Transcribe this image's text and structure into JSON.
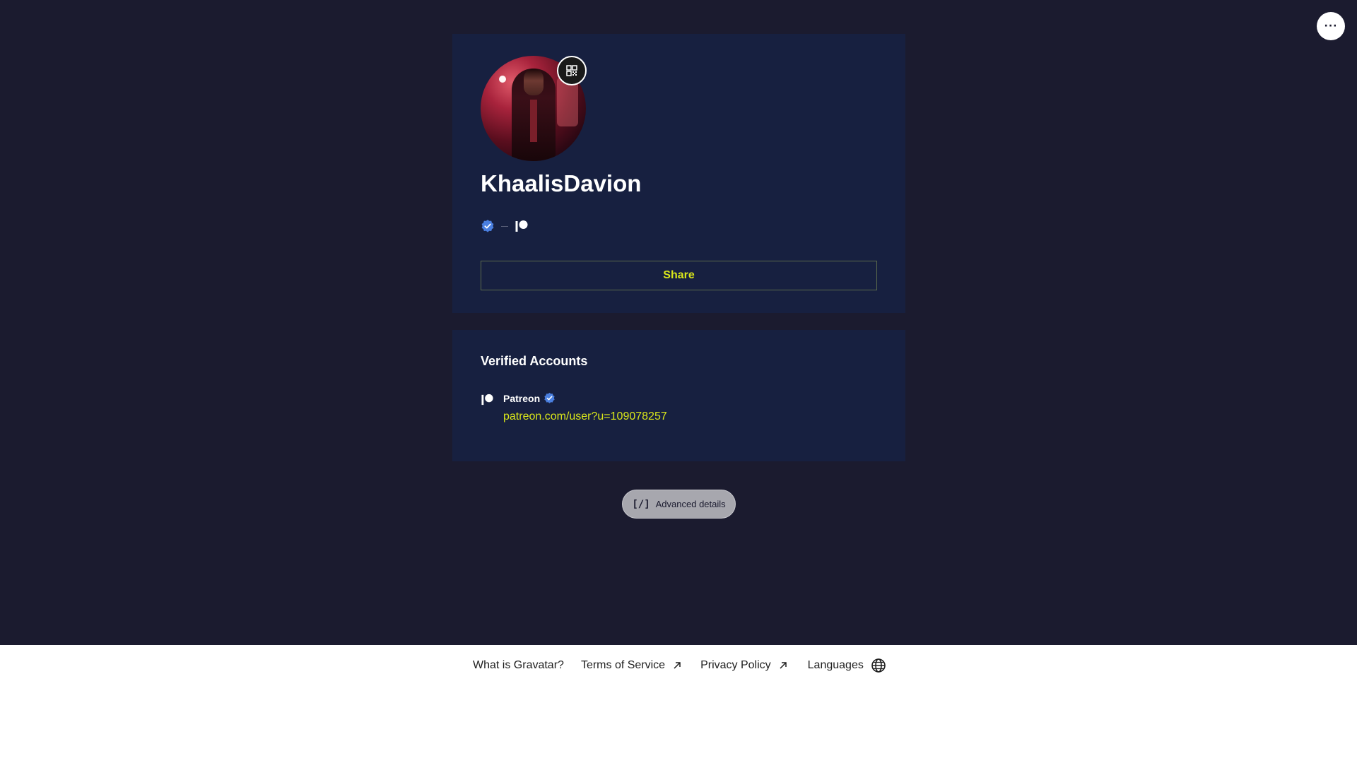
{
  "header": {
    "more_label": "···"
  },
  "profile": {
    "display_name": "KhaalisDavion",
    "share_label": "Share"
  },
  "verified": {
    "title": "Verified Accounts",
    "accounts": [
      {
        "name": "Patreon",
        "url": "patreon.com/user?u=109078257"
      }
    ]
  },
  "advanced": {
    "icon_text": "[/]",
    "label": "Advanced details"
  },
  "footer": {
    "links": [
      {
        "label": "What is Gravatar?"
      },
      {
        "label": "Terms of Service"
      },
      {
        "label": "Privacy Policy"
      },
      {
        "label": "Languages"
      }
    ]
  },
  "colors": {
    "page_background": "#1b1b2f",
    "card_background": "#172040",
    "accent": "#d9e61a",
    "verified_badge": "#4a7fe0"
  },
  "icons": {
    "qr": "qr-code-icon",
    "verified": "verified-badge-icon",
    "patreon": "patreon-icon",
    "external": "external-link-icon",
    "globe": "globe-icon"
  }
}
